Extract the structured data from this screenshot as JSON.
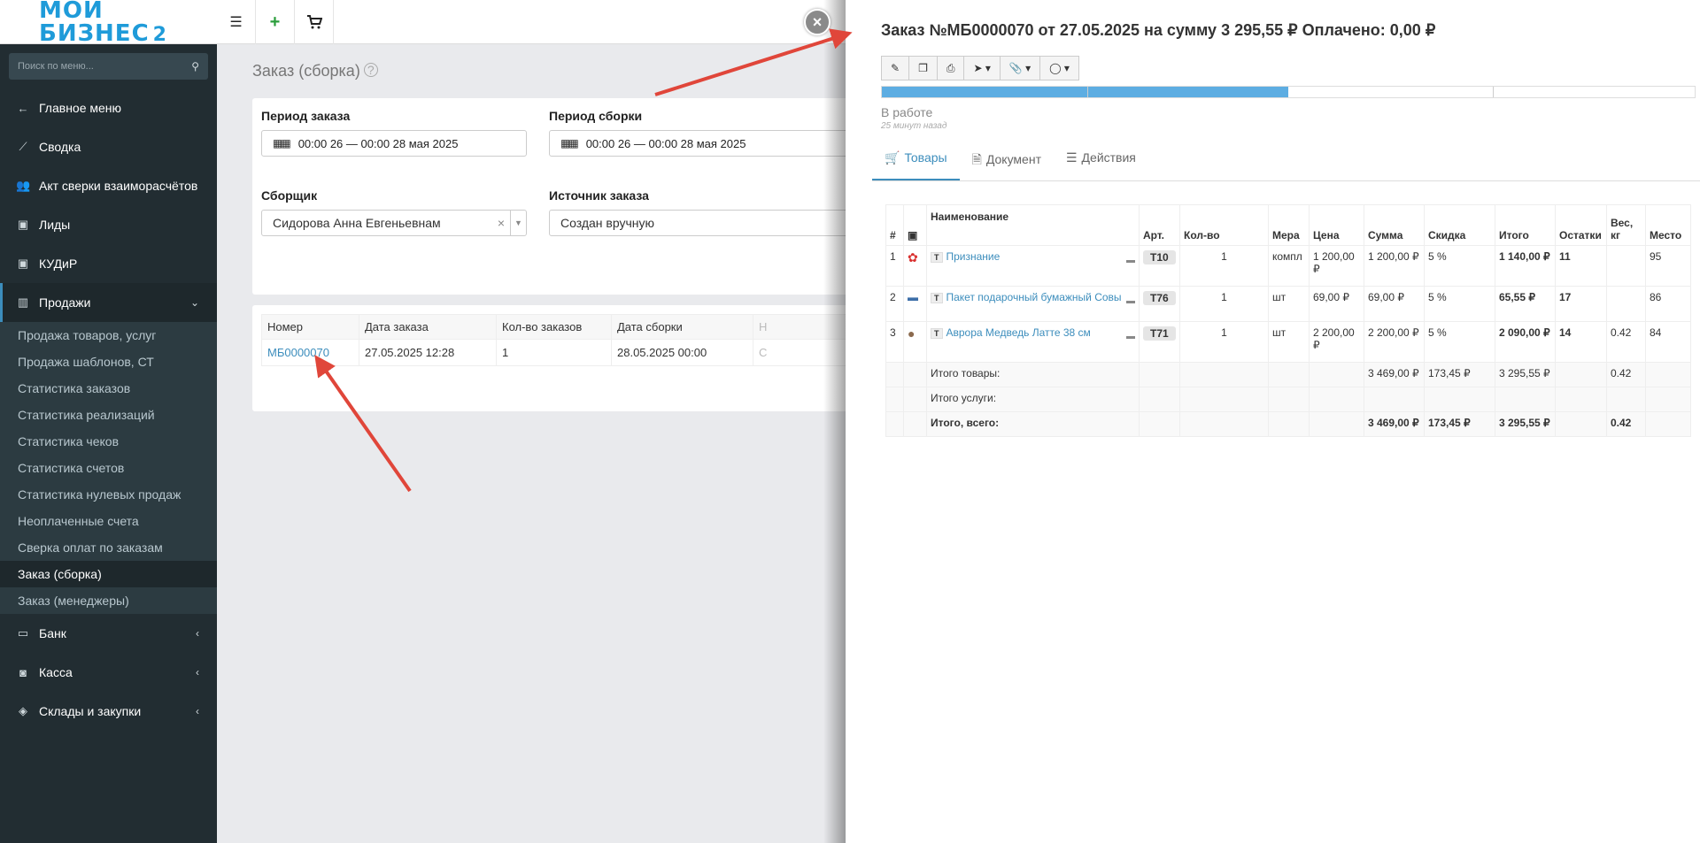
{
  "logo": {
    "text": "МОЙ БИЗНЕС",
    "suffix": "2"
  },
  "sidebar": {
    "search_placeholder": "Поиск по меню...",
    "items": [
      {
        "label": "Главное меню",
        "icon": "←"
      },
      {
        "label": "Сводка",
        "icon": "⟋"
      },
      {
        "label": "Акт сверки взаиморасчётов",
        "icon": "👥"
      },
      {
        "label": "Лиды",
        "icon": "▣"
      },
      {
        "label": "КУДиР",
        "icon": "▣"
      },
      {
        "label": "Продажи",
        "icon": "▥"
      }
    ],
    "sales_sub": [
      "Продажа товаров, услуг",
      "Продажа шаблонов, СТ",
      "Статистика заказов",
      "Статистика реализаций",
      "Статистика чеков",
      "Статистика счетов",
      "Статистика нулевых продаж",
      "Неоплаченные счета",
      "Сверка оплат по заказам",
      "Заказ (сборка)",
      "Заказ (менеджеры)"
    ],
    "bottom_items": [
      {
        "label": "Банк",
        "icon": "▭"
      },
      {
        "label": "Касса",
        "icon": "◙"
      },
      {
        "label": "Склады и закупки",
        "icon": "◈"
      }
    ]
  },
  "main": {
    "title": "Заказ (сборка)",
    "filters": {
      "order_period_label": "Период заказа",
      "order_period_value": "00:00 26 — 00:00 28 мая 2025",
      "assembly_period_label": "Период сборки",
      "assembly_period_value": "00:00 26 — 00:00 28 мая 2025",
      "assembler_label": "Сборщик",
      "assembler_value": "Сидорова Анна Евгеньевнам",
      "source_label": "Источник заказа",
      "source_value": "Создан вручную"
    },
    "table": {
      "headers": [
        "Номер",
        "Дата заказа",
        "Кол-во заказов",
        "Дата сборки",
        "Н"
      ],
      "row": {
        "number": "МБ0000070",
        "order_date": "27.05.2025 12:28",
        "count": "1",
        "assembly_date": "28.05.2025 00:00",
        "extra": "С"
      }
    }
  },
  "panel": {
    "title": "Заказ №МБ0000070 от 27.05.2025 на сумму 3 295,55 ₽ Оплачено: 0,00 ₽",
    "progress": 0.5,
    "status": "В работе",
    "status_time": "25 минут назад",
    "tabs": [
      "Товары",
      "Документ",
      "Действия"
    ],
    "headers": [
      "#",
      "",
      "Наименование",
      "Арт.",
      "Кол-во",
      "Мера",
      "Цена",
      "Сумма",
      "Скидка",
      "Итого",
      "Остатки",
      "Вес, кг",
      "Место"
    ],
    "items": [
      {
        "n": "1",
        "type": "Т",
        "name": "Признание",
        "art": "Т10",
        "qty": "1",
        "unit": "компл",
        "price": "1 200,00 ₽",
        "sum": "1 200,00 ₽",
        "discount": "5 %",
        "total": "1 140,00 ₽",
        "stock": "11",
        "weight": "",
        "place": "95"
      },
      {
        "n": "2",
        "type": "Т",
        "name": "Пакет подарочный бумажный Совы",
        "art": "Т76",
        "qty": "1",
        "unit": "шт",
        "price": "69,00 ₽",
        "sum": "69,00 ₽",
        "discount": "5 %",
        "total": "65,55 ₽",
        "stock": "17",
        "weight": "",
        "place": "86"
      },
      {
        "n": "3",
        "type": "Т",
        "name": "Аврора Медведь Латте 38 см",
        "art": "Т71",
        "qty": "1",
        "unit": "шт",
        "price": "2 200,00 ₽",
        "sum": "2 200,00 ₽",
        "discount": "5 %",
        "total": "2 090,00 ₽",
        "stock": "14",
        "weight": "0.42",
        "place": "84"
      }
    ],
    "totals": {
      "goods_label": "Итого товары:",
      "goods_sum": "3 469,00 ₽",
      "goods_discount": "173,45 ₽",
      "goods_total": "3 295,55 ₽",
      "goods_weight": "0.42",
      "services_label": "Итого услуги:",
      "all_label": "Итого, всего:",
      "all_sum": "3 469,00 ₽",
      "all_discount": "173,45 ₽",
      "all_total": "3 295,55 ₽",
      "all_weight": "0.42"
    }
  },
  "colors": {
    "sidebar": "#222d32",
    "accent": "#3c8dbc",
    "progress": "#5dade2",
    "arrow": "#e0463a",
    "stock": "#2a9d3b"
  }
}
